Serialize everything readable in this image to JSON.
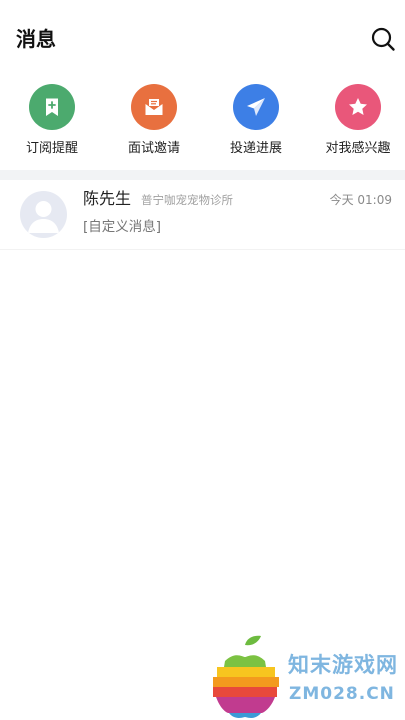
{
  "header": {
    "title": "消息"
  },
  "quick_actions": [
    {
      "label": "订阅提醒",
      "icon": "bookmark-plus-icon",
      "color": "#4caa6e"
    },
    {
      "label": "面试邀请",
      "icon": "envelope-icon",
      "color": "#e8703f"
    },
    {
      "label": "投递进展",
      "icon": "paper-plane-icon",
      "color": "#3d7fe6"
    },
    {
      "label": "对我感兴趣",
      "icon": "star-icon",
      "color": "#e9577a"
    }
  ],
  "conversations": [
    {
      "name": "陈先生",
      "company": "普宁咖宠宠物诊所",
      "time": "今天 01:09",
      "preview": "[自定义消息]",
      "avatar": "default-avatar-icon"
    }
  ],
  "watermark": {
    "cn": "知末游戏网",
    "en": "ZM028.CN"
  },
  "colors": {
    "background": "#ffffff",
    "divider": "#f2f3f5",
    "watermark": "#7fb6e0"
  }
}
